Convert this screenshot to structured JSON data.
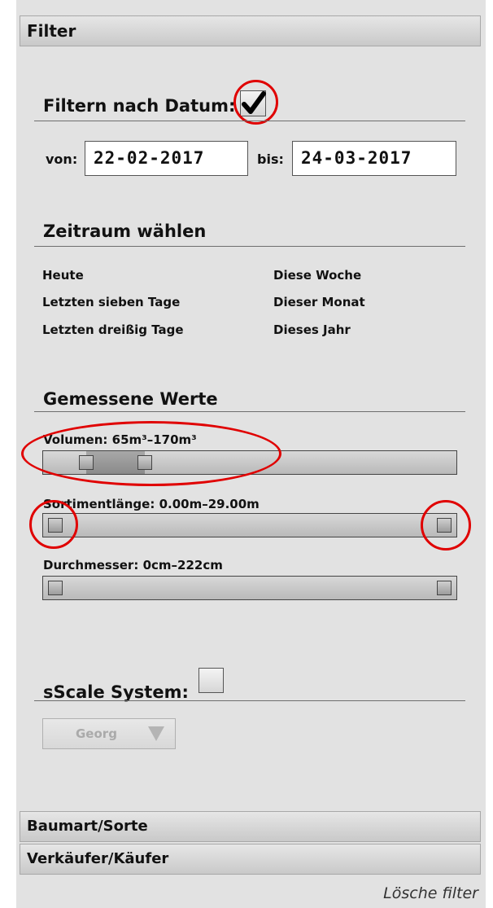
{
  "panel": {
    "header": "Filter",
    "footer_sections": [
      "Baumart/Sorte",
      "Verkäufer/Käufer"
    ],
    "reset_link": "Lösche filter"
  },
  "date_filter": {
    "title": "Filtern nach Datum:",
    "checked": true,
    "from_label": "von:",
    "from_value": "22-02-2017",
    "to_label": "bis:",
    "to_value": "24-03-2017"
  },
  "period": {
    "title": "Zeitraum wählen",
    "options": [
      "Heute",
      "Diese Woche",
      "Letzten sieben Tage",
      "Dieser Monat",
      "Letzten dreißig Tage",
      "Dieses Jahr"
    ]
  },
  "measured": {
    "title": "Gemessene Werte",
    "sliders": [
      {
        "label": "Volumen:",
        "value": "65m³–170m³",
        "min_fraction": 0.08,
        "max_fraction": 0.23
      },
      {
        "label": "Sortimentlänge:",
        "value": "0.00m–29.00m",
        "min_fraction": 0.0,
        "max_fraction": 1.0
      },
      {
        "label": "Durchmesser:",
        "value": "0cm–222cm",
        "min_fraction": 0.0,
        "max_fraction": 1.0
      }
    ]
  },
  "sscale": {
    "title": "sScale System:",
    "checked": false,
    "select_value": "Georg"
  },
  "colors": {
    "panel_bg": "#e2e2e2",
    "annotation": "#e00000"
  }
}
